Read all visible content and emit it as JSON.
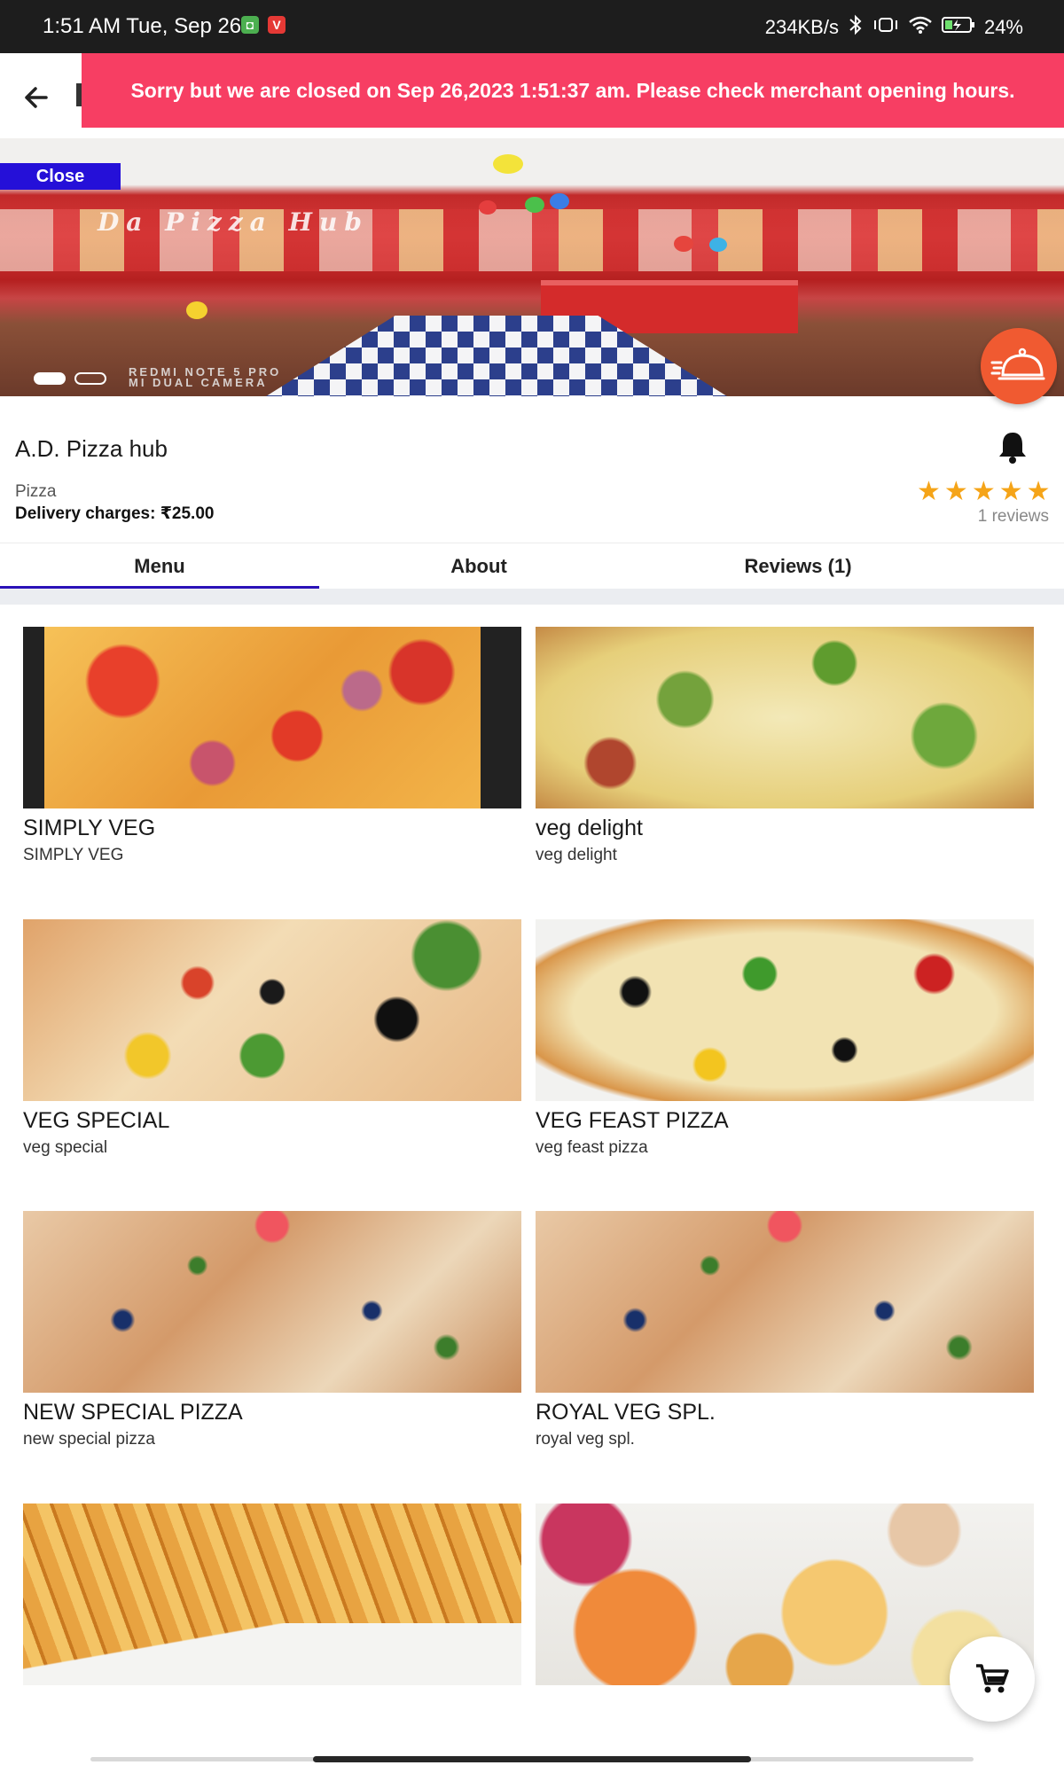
{
  "status_bar": {
    "time": "1:51 AM Tue, Sep 26",
    "network_speed": "234KB/s",
    "battery": "24%",
    "icons": [
      "app-notification-icon",
      "app-v-icon",
      "bluetooth-icon",
      "vibrate-icon",
      "wifi-icon",
      "battery-charging-icon"
    ]
  },
  "banner": {
    "message": "Sorry but we are closed on Sep 26,2023 1:51:37 am. Please check merchant opening hours.",
    "color": "#f73e63"
  },
  "hero": {
    "close_label": "Close",
    "sign_text": "Da Pizza Hub",
    "watermark_line1": "REDMI NOTE 5 PRO",
    "watermark_line2": "MI DUAL CAMERA",
    "slide_count": 2,
    "active_slide": 1
  },
  "merchant": {
    "name": "A.D. Pizza hub",
    "category": "Pizza",
    "delivery_charges": "Delivery charges: ₹25.00",
    "rating": 5,
    "reviews_label": "1 reviews"
  },
  "tabs": [
    {
      "label": "Menu",
      "active": true
    },
    {
      "label": "About",
      "active": false
    },
    {
      "label": "Reviews (1)",
      "active": false
    }
  ],
  "menu": [
    {
      "title": "SIMPLY VEG",
      "subtitle": "SIMPLY VEG"
    },
    {
      "title": "veg delight",
      "subtitle": "veg delight"
    },
    {
      "title": "VEG SPECIAL",
      "subtitle": "veg special"
    },
    {
      "title": "VEG FEAST PIZZA",
      "subtitle": "veg feast pizza"
    },
    {
      "title": "NEW SPECIAL PIZZA",
      "subtitle": "new special pizza"
    },
    {
      "title": "ROYAL VEG SPL.",
      "subtitle": "royal veg spl."
    }
  ],
  "colors": {
    "accent_tab": "#2a12b8",
    "close_tag": "#2510d8",
    "delivery_fab": "#f05a31",
    "stars": "#f5a418"
  }
}
